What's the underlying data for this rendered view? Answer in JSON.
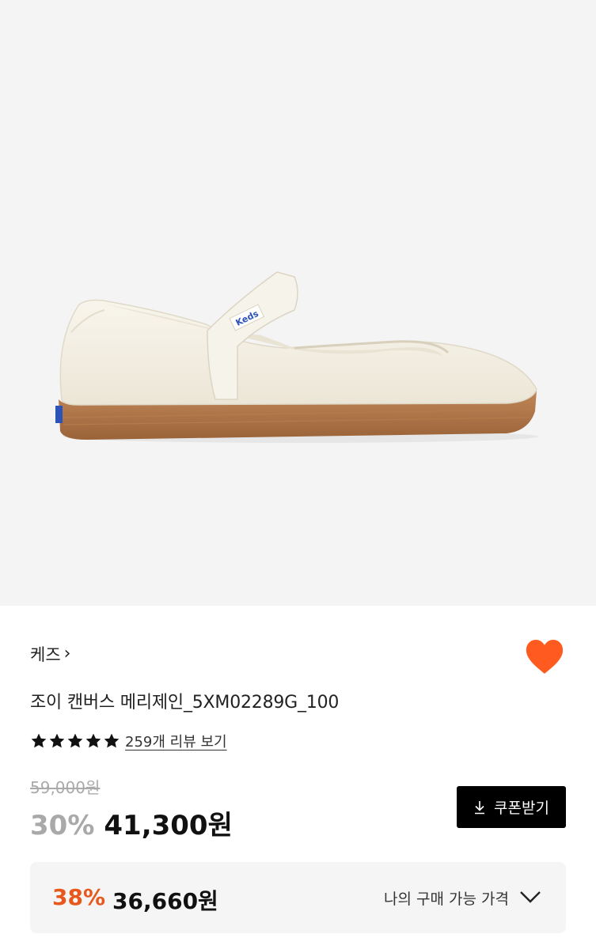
{
  "product": {
    "image_alt": "Keds white canvas mary jane shoe with gum sole",
    "logo_text": "Keds",
    "brand": "케즈",
    "brand_chevron": "›",
    "title": "조이 캔버스 메리제인_5XM02289G_100",
    "rating_stars": 5,
    "review_link": "259개 리뷰 보기",
    "wishlisted": true,
    "heart_color": "#ff5a1f"
  },
  "pricing": {
    "original_price": "59,000원",
    "discount_percent": "30%",
    "sale_price": "41,300원",
    "coupon_button": "쿠폰받기"
  },
  "my_price": {
    "discount_percent": "38%",
    "price": "36,660원",
    "label": "나의 구매 가능 가격",
    "accent_color": "#e8581c"
  }
}
